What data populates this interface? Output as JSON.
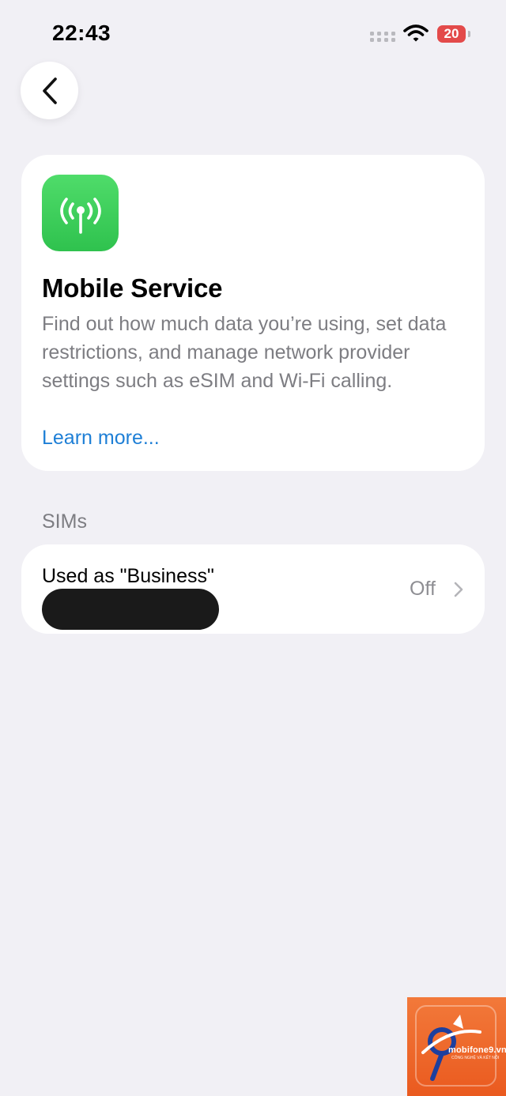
{
  "status_bar": {
    "time": "22:43",
    "battery_level": "20",
    "battery_color": "#e34a4a"
  },
  "header": {
    "back_icon": "chevron-left-icon"
  },
  "info_card": {
    "icon": "antenna-icon",
    "icon_color": "#34c759",
    "title": "Mobile Service",
    "description": "Find out how much data you’re using, set data restrictions, and manage network provider settings such as eSIM and Wi-Fi calling.",
    "link_text": "Learn more...",
    "link_color": "#1e7fd6"
  },
  "sims_section": {
    "header": "SIMs",
    "items": [
      {
        "label": "Used as \"Business\"",
        "value": "Off",
        "number_redacted": true
      }
    ]
  },
  "watermark": {
    "brand": "mobifone9",
    "domain": ".vn",
    "tagline": "CÔNG NGHỆ VÀ KẾT NỐI"
  }
}
